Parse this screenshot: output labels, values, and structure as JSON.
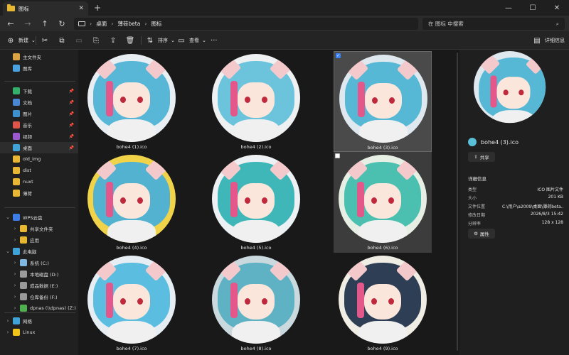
{
  "window": {
    "tab_title": "图标",
    "new_tab": "+",
    "controls": {
      "minimize": "—",
      "maximize": "☐",
      "close": "✕"
    }
  },
  "nav": {
    "back": "←",
    "forward": "→",
    "up": "↑",
    "refresh": "↻",
    "breadcrumbs": [
      "桌面",
      "薄荷beta",
      "图标"
    ],
    "search_placeholder": "在 图标 中搜索"
  },
  "toolbar": {
    "new_label": "新建",
    "sort_label": "排序",
    "view_label": "查看",
    "more_label": "···",
    "details_label": "详细信息"
  },
  "sidebar": {
    "items": [
      {
        "label": "主文件夹",
        "icon": "home-icon",
        "color": "#d9a441"
      },
      {
        "label": "图库",
        "icon": "gallery-icon",
        "color": "#4aa3e0"
      },
      {
        "label": "下载",
        "icon": "download-icon",
        "color": "#35b06a",
        "pinned": true
      },
      {
        "label": "文档",
        "icon": "document-icon",
        "color": "#4a86d4",
        "pinned": true
      },
      {
        "label": "图片",
        "icon": "pictures-icon",
        "color": "#3c90d0",
        "pinned": true
      },
      {
        "label": "音乐",
        "icon": "music-icon",
        "color": "#e0554a",
        "pinned": true
      },
      {
        "label": "视频",
        "icon": "video-icon",
        "color": "#9b59d0",
        "pinned": true
      },
      {
        "label": "桌面",
        "icon": "desktop-icon",
        "color": "#3fa3d8",
        "pinned": true,
        "selected": true
      },
      {
        "label": "old_img",
        "icon": "folder-icon",
        "color": "#e8b731"
      },
      {
        "label": "dist",
        "icon": "folder-icon",
        "color": "#e8b731"
      },
      {
        "label": "nuxt",
        "icon": "folder-icon",
        "color": "#e8b731"
      },
      {
        "label": "薄荷",
        "icon": "folder-icon",
        "color": "#e8b731"
      },
      {
        "label": "WPS云盘",
        "icon": "cloud-icon",
        "color": "#3d7ee6",
        "chevron": "⌄"
      },
      {
        "label": "共享文件夹",
        "icon": "folder-icon",
        "color": "#e8b731",
        "chevron": "›"
      },
      {
        "label": "应用",
        "icon": "folder-icon",
        "color": "#e8b731",
        "chevron": "›"
      },
      {
        "label": "此电脑",
        "icon": "computer-icon",
        "color": "#3fa3d8",
        "chevron": "⌄"
      },
      {
        "label": "系统 (C:)",
        "icon": "drive-icon",
        "color": "#7fb7e0",
        "chevron": "›"
      },
      {
        "label": "本地磁盘 (D:)",
        "icon": "drive-icon",
        "color": "#9a9a9a",
        "chevron": "›"
      },
      {
        "label": "成品数据 (E:)",
        "icon": "drive-icon",
        "color": "#9a9a9a",
        "chevron": "›"
      },
      {
        "label": "仓库备份 (F:)",
        "icon": "drive-icon",
        "color": "#9a9a9a",
        "chevron": "›"
      },
      {
        "label": "dpnas (\\\\dpnas) (Z:)",
        "icon": "network-drive-icon",
        "color": "#4fb04f",
        "chevron": "›"
      },
      {
        "label": "网络",
        "icon": "network-icon",
        "color": "#3fa3d8",
        "chevron": "›"
      },
      {
        "label": "Linux",
        "icon": "linux-icon",
        "color": "#f0c419",
        "chevron": "›"
      }
    ]
  },
  "files": [
    {
      "name": "bohe4 (1).ico",
      "bg": "#e9eef2",
      "hair": "#58b6d6"
    },
    {
      "name": "bohe4 (2).ico",
      "bg": "#eef0f2",
      "hair": "#6cc3dc"
    },
    {
      "name": "bohe4 (3).ico",
      "bg": "#dfe8ee",
      "hair": "#56b8d4",
      "selected": true,
      "checked": true
    },
    {
      "name": "bohe4 (4).ico",
      "bg": "#f1d34a",
      "hair": "#53b2cf"
    },
    {
      "name": "bohe4 (5).ico",
      "bg": "#eef1f3",
      "hair": "#3fb7b8"
    },
    {
      "name": "bohe4 (6).ico",
      "bg": "#e7efe4",
      "hair": "#4cc0b0",
      "hover": true
    },
    {
      "name": "bohe4 (7).ico",
      "bg": "#e6eef4",
      "hair": "#5bbde0"
    },
    {
      "name": "bohe4 (8).ico",
      "bg": "#c9d9de",
      "hair": "#5fb2c4"
    },
    {
      "name": "bohe4 (9).ico",
      "bg": "#f0eee4",
      "hair": "#2e3f55"
    }
  ],
  "details": {
    "file_name": "bohe4 (3).ico",
    "share_label": "共享",
    "section_title": "详细信息",
    "rows": [
      {
        "k": "类型",
        "v": "ICO 图片文件"
      },
      {
        "k": "大小",
        "v": "201 KB"
      },
      {
        "k": "文件位置",
        "v": "C:\\用户\\a2009\\桌面\\薄荷beta..."
      },
      {
        "k": "修改日期",
        "v": "2026/8/3 15:42"
      },
      {
        "k": "分辨率",
        "v": "128 x 128"
      }
    ],
    "properties_label": "属性"
  }
}
